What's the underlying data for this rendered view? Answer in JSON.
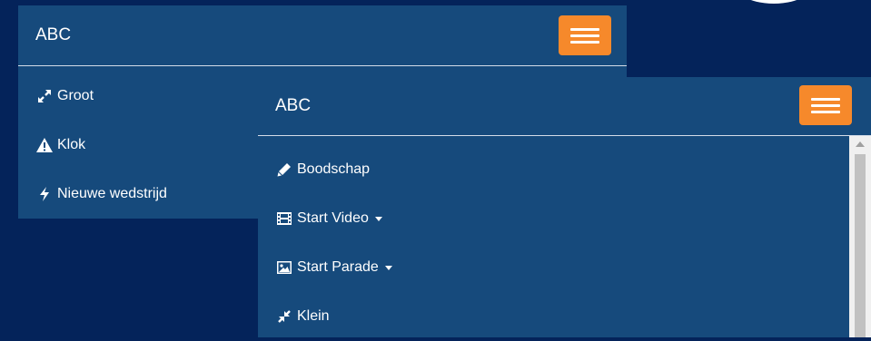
{
  "back_panel": {
    "brand": "ABC",
    "menu_toggle_icon": "hamburger-icon",
    "items": [
      {
        "label": "Groot",
        "icon": "expand-icon"
      },
      {
        "label": "Klok",
        "icon": "warning-icon"
      },
      {
        "label": "Nieuwe wedstrijd",
        "icon": "bolt-icon"
      }
    ]
  },
  "front_panel": {
    "brand": "ABC",
    "menu_toggle_icon": "hamburger-icon",
    "items": [
      {
        "label": "Boodschap",
        "icon": "pencil-icon",
        "dropdown": false
      },
      {
        "label": "Start Video",
        "icon": "film-icon",
        "dropdown": true
      },
      {
        "label": "Start Parade",
        "icon": "picture-icon",
        "dropdown": true
      },
      {
        "label": "Klein",
        "icon": "compress-icon",
        "dropdown": false
      }
    ]
  },
  "colors": {
    "page_background": "#04235a",
    "navbar_background": "#164a7c",
    "toggle_button": "#f6892b",
    "text": "#ffffff"
  }
}
